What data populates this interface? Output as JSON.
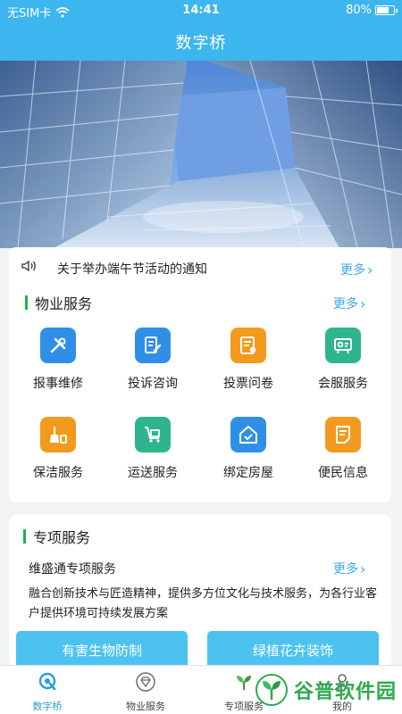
{
  "status": {
    "carrier": "无SIM卡",
    "time": "14:41",
    "battery": "80%"
  },
  "nav": {
    "title": "数字桥"
  },
  "notice": {
    "text": "关于举办端午节活动的通知",
    "more": "更多"
  },
  "property": {
    "title": "物业服务",
    "more": "更多",
    "items": [
      {
        "label": "报事维修",
        "icon": "tools-icon",
        "color": "#2f8fe6"
      },
      {
        "label": "投诉咨询",
        "icon": "edit-doc-icon",
        "color": "#2f8fe6"
      },
      {
        "label": "投票问卷",
        "icon": "ballot-icon",
        "color": "#f29a1e"
      },
      {
        "label": "会服服务",
        "icon": "meeting-board-icon",
        "color": "#2fb58e"
      },
      {
        "label": "保洁服务",
        "icon": "broom-icon",
        "color": "#f29a1e"
      },
      {
        "label": "运送服务",
        "icon": "cart-icon",
        "color": "#2fb58e"
      },
      {
        "label": "绑定房屋",
        "icon": "house-check-icon",
        "color": "#2f8fe6"
      },
      {
        "label": "便民信息",
        "icon": "note-icon",
        "color": "#f29a1e"
      }
    ]
  },
  "special": {
    "title": "专项服务",
    "subtitle": "维盛通专项服务",
    "more": "更多",
    "description": "融合创新技术与匠造精神，提供多方位文化与技术服务，为各行业客户提供环境可持续发展方案",
    "buttons": [
      "有害生物防制",
      "绿植花卉装饰"
    ]
  },
  "tabs": [
    {
      "label": "数字桥",
      "icon": "home-q-icon",
      "active": true
    },
    {
      "label": "物业服务",
      "icon": "diamond-icon",
      "active": false
    },
    {
      "label": "专项服务",
      "icon": "plant-icon",
      "active": false
    },
    {
      "label": "我的",
      "icon": "user-icon",
      "active": false
    }
  ],
  "watermark": {
    "text": "谷普软件园"
  },
  "colors": {
    "primary": "#3db5ee",
    "accent_green": "#22b14c",
    "link": "#3aa7e6"
  }
}
